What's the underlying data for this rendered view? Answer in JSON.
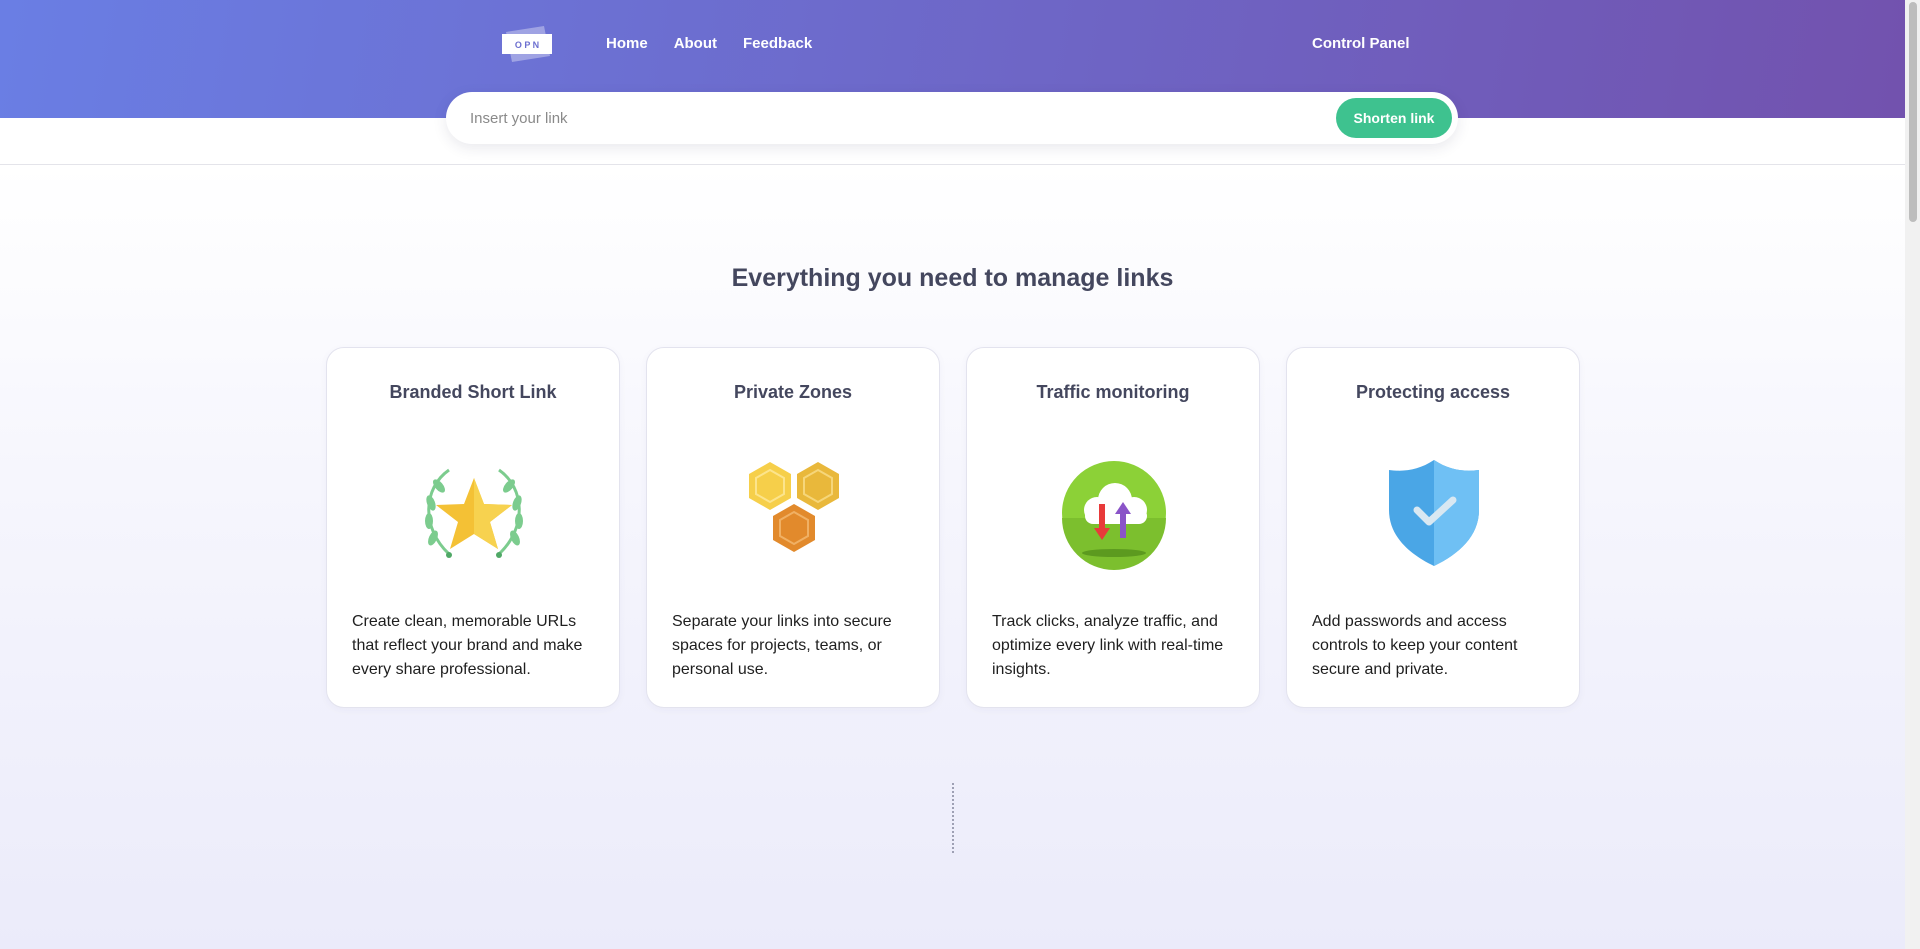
{
  "brand": {
    "logo_text": "O P N"
  },
  "nav": {
    "items": [
      {
        "label": "Home"
      },
      {
        "label": "About"
      },
      {
        "label": "Feedback"
      }
    ],
    "control_panel": "Control Panel"
  },
  "search": {
    "placeholder": "Insert your link",
    "value": "",
    "button_label": "Shorten link"
  },
  "features": {
    "title": "Everything you need to manage links",
    "cards": [
      {
        "title": "Branded Short Link",
        "icon": "laurel-star-icon",
        "description": "Create clean, memorable URLs that reflect your brand and make every share professional."
      },
      {
        "title": "Private Zones",
        "icon": "honeycomb-icon",
        "description": "Separate your links into secure spaces for projects, teams, or personal use."
      },
      {
        "title": "Traffic monitoring",
        "icon": "cloud-traffic-icon",
        "description": "Track clicks, analyze traffic, and optimize every link with real-time insights."
      },
      {
        "title": "Protecting access",
        "icon": "shield-check-icon",
        "description": "Add passwords and access controls to keep your content secure and private."
      }
    ]
  },
  "colors": {
    "header_gradient_start": "#6a7ee4",
    "header_gradient_end": "#7252ae",
    "accent_green": "#3ec28f",
    "heading_text": "#44475e"
  }
}
